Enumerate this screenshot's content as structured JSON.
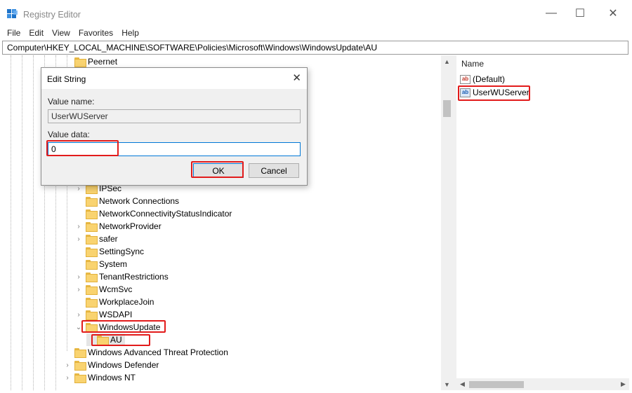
{
  "window": {
    "title": "Registry Editor",
    "minimize_glyph": "—",
    "maximize_glyph": "☐",
    "close_glyph": "✕"
  },
  "menu": [
    "File",
    "Edit",
    "View",
    "Favorites",
    "Help"
  ],
  "address_bar": {
    "path": "Computer\\HKEY_LOCAL_MACHINE\\SOFTWARE\\Policies\\Microsoft\\Windows\\WindowsUpdate\\AU"
  },
  "tree": {
    "items": [
      {
        "label": "Peernet",
        "expander": ""
      },
      {
        "label": "IPSec",
        "expander": "›"
      },
      {
        "label": "Network Connections",
        "expander": ""
      },
      {
        "label": "NetworkConnectivityStatusIndicator",
        "expander": ""
      },
      {
        "label": "NetworkProvider",
        "expander": "›"
      },
      {
        "label": "safer",
        "expander": "›"
      },
      {
        "label": "SettingSync",
        "expander": ""
      },
      {
        "label": "System",
        "expander": ""
      },
      {
        "label": "TenantRestrictions",
        "expander": "›"
      },
      {
        "label": "WcmSvc",
        "expander": "›"
      },
      {
        "label": "WorkplaceJoin",
        "expander": ""
      },
      {
        "label": "WSDAPI",
        "expander": "›"
      },
      {
        "label": "WindowsUpdate",
        "expander": "⌄"
      },
      {
        "label": "AU",
        "expander": ""
      },
      {
        "label": "Windows Advanced Threat Protection",
        "expander": ""
      },
      {
        "label": "Windows Defender",
        "expander": "›"
      },
      {
        "label": "Windows NT",
        "expander": "›"
      }
    ]
  },
  "values_pane": {
    "column_name": "Name",
    "rows": [
      {
        "name": "(Default)",
        "icon": "string-value-icon",
        "selected": false
      },
      {
        "name": "UserWUServer",
        "icon": "string-value-icon",
        "selected": true
      }
    ]
  },
  "dialog": {
    "title": "Edit String",
    "close_glyph": "✕",
    "value_name_label": "Value name:",
    "value_name": "UserWUServer",
    "value_data_label": "Value data:",
    "value_data": "0",
    "ok_label": "OK",
    "cancel_label": "Cancel"
  },
  "colors": {
    "highlight_red": "#e21b1b",
    "focus_blue": "#0078d7",
    "folder_yellow": "#f9d370"
  }
}
